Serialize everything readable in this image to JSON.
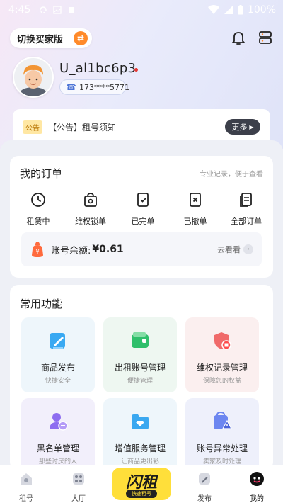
{
  "status_bar": {
    "time": "4:45",
    "battery": "100%"
  },
  "header": {
    "switch_label": "切换买家版"
  },
  "profile": {
    "username": "U_al1bc6p3",
    "phone": "173****5771"
  },
  "notice": {
    "tag": "公告",
    "text": "【公告】租号须知",
    "more_label": "更多"
  },
  "orders": {
    "title": "我的订单",
    "hint": "专业记录，便于查看",
    "items": [
      {
        "label": "租赁中",
        "icon": "clock-icon"
      },
      {
        "label": "维权锁单",
        "icon": "lock-bag-icon"
      },
      {
        "label": "已完单",
        "icon": "check-doc-icon"
      },
      {
        "label": "已撤单",
        "icon": "cancel-doc-icon"
      },
      {
        "label": "全部订单",
        "icon": "all-orders-icon"
      }
    ],
    "balance_label": "账号余额:",
    "balance_value": "¥0.61",
    "balance_link": "去看看"
  },
  "common": {
    "title": "常用功能",
    "items": [
      {
        "title": "商品发布",
        "sub": "快捷安全",
        "icon": "publish-icon"
      },
      {
        "title": "出租账号管理",
        "sub": "便捷管理",
        "icon": "wallet-icon"
      },
      {
        "title": "维权记录管理",
        "sub": "保障您的权益",
        "icon": "shield-icon"
      },
      {
        "title": "黑名单管理",
        "sub": "那些讨厌的人",
        "icon": "blacklist-icon"
      },
      {
        "title": "增值服务管理",
        "sub": "让商品更出彩",
        "icon": "folder-diamond-icon"
      },
      {
        "title": "账号异常处理",
        "sub": "卖家及时处理",
        "icon": "bag-warning-icon"
      }
    ]
  },
  "bottom_nav": {
    "items": [
      {
        "label": "租号"
      },
      {
        "label": "大厅"
      },
      {
        "label": "发布"
      },
      {
        "label": "我的"
      }
    ],
    "flash_main": "闪租",
    "flash_sub": "快速租号"
  },
  "colors": {
    "accent": "#ff8a2a",
    "flash_yellow": "#ffdf3a",
    "danger": "#e53935",
    "primary_blue": "#4b73d6"
  }
}
